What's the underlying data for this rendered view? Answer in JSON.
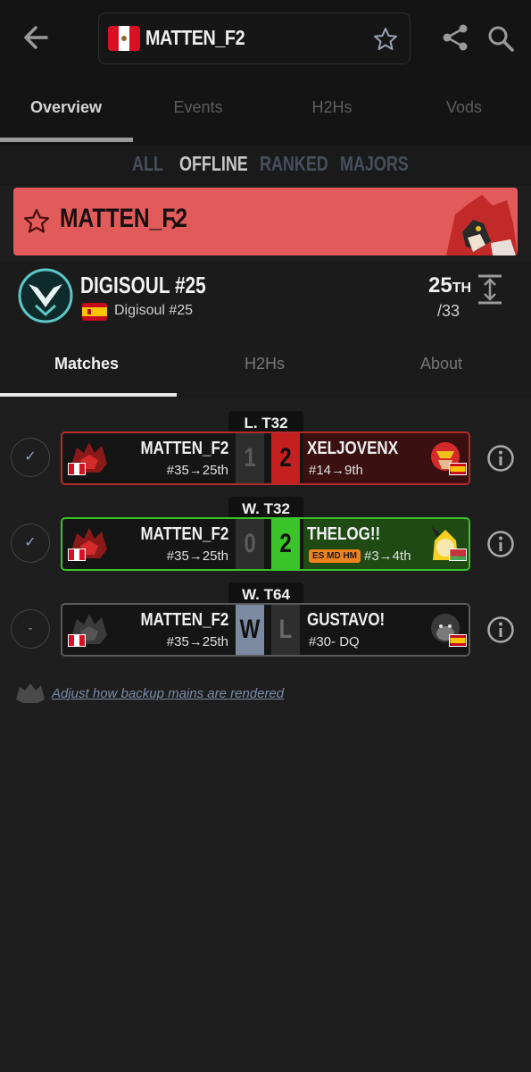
{
  "header": {
    "title": "MATTEN_F2",
    "back_icon": "arrow-left-icon",
    "favorite_icon": "star-outline-icon",
    "share_icon": "share-icon",
    "search_icon": "search-icon"
  },
  "primary_tabs": [
    {
      "label": "Overview",
      "active": true
    },
    {
      "label": "Events",
      "active": false
    },
    {
      "label": "H2Hs",
      "active": false
    },
    {
      "label": "Vods",
      "active": false
    }
  ],
  "filters": [
    {
      "label": "ALL",
      "active": false
    },
    {
      "label": "OFFLINE",
      "active": true
    },
    {
      "label": "RANKED",
      "active": false
    },
    {
      "label": "MAJORS",
      "active": false
    }
  ],
  "banner": {
    "name": "MATTEN_F2",
    "chevron": "›",
    "color": "#e25b5b"
  },
  "event": {
    "name": "DIGISOUL #25",
    "subtitle": "Digisoul #25",
    "placement": "25",
    "placement_suffix": "TH",
    "total": "/33"
  },
  "secondary_tabs": [
    {
      "label": "Matches",
      "active": true
    },
    {
      "label": "H2Hs",
      "active": false
    },
    {
      "label": "About",
      "active": false
    }
  ],
  "matches": [
    {
      "round": "L. T32",
      "status": "✓",
      "left": {
        "name": "MATTEN_F2",
        "seed": "#35→25th",
        "score": "1"
      },
      "right": {
        "name": "XELJOVENX",
        "seed": "#14→9th",
        "score": "2"
      },
      "right_color": "#3a1010",
      "score_color": "#c42020"
    },
    {
      "round": "W. T32",
      "status": "✓",
      "left": {
        "name": "MATTEN_F2",
        "seed": "#35→25th",
        "score": "0"
      },
      "right": {
        "name": "THELOG!!",
        "badge": "ES MD HM",
        "seed": "#3→4th",
        "score": "2"
      },
      "right_color": "#1f4a14",
      "score_color": "#3bc42a"
    },
    {
      "round": "W. T64",
      "status": "-",
      "left": {
        "name": "MATTEN_F2",
        "seed": "#35→25th",
        "score": "W"
      },
      "right": {
        "name": "GUSTAVO!",
        "seed": "#30- DQ",
        "score": "L"
      },
      "right_color": "#151515",
      "score_color": "#2e2e2e"
    }
  ],
  "footer_link": "Adjust how backup mains are rendered"
}
